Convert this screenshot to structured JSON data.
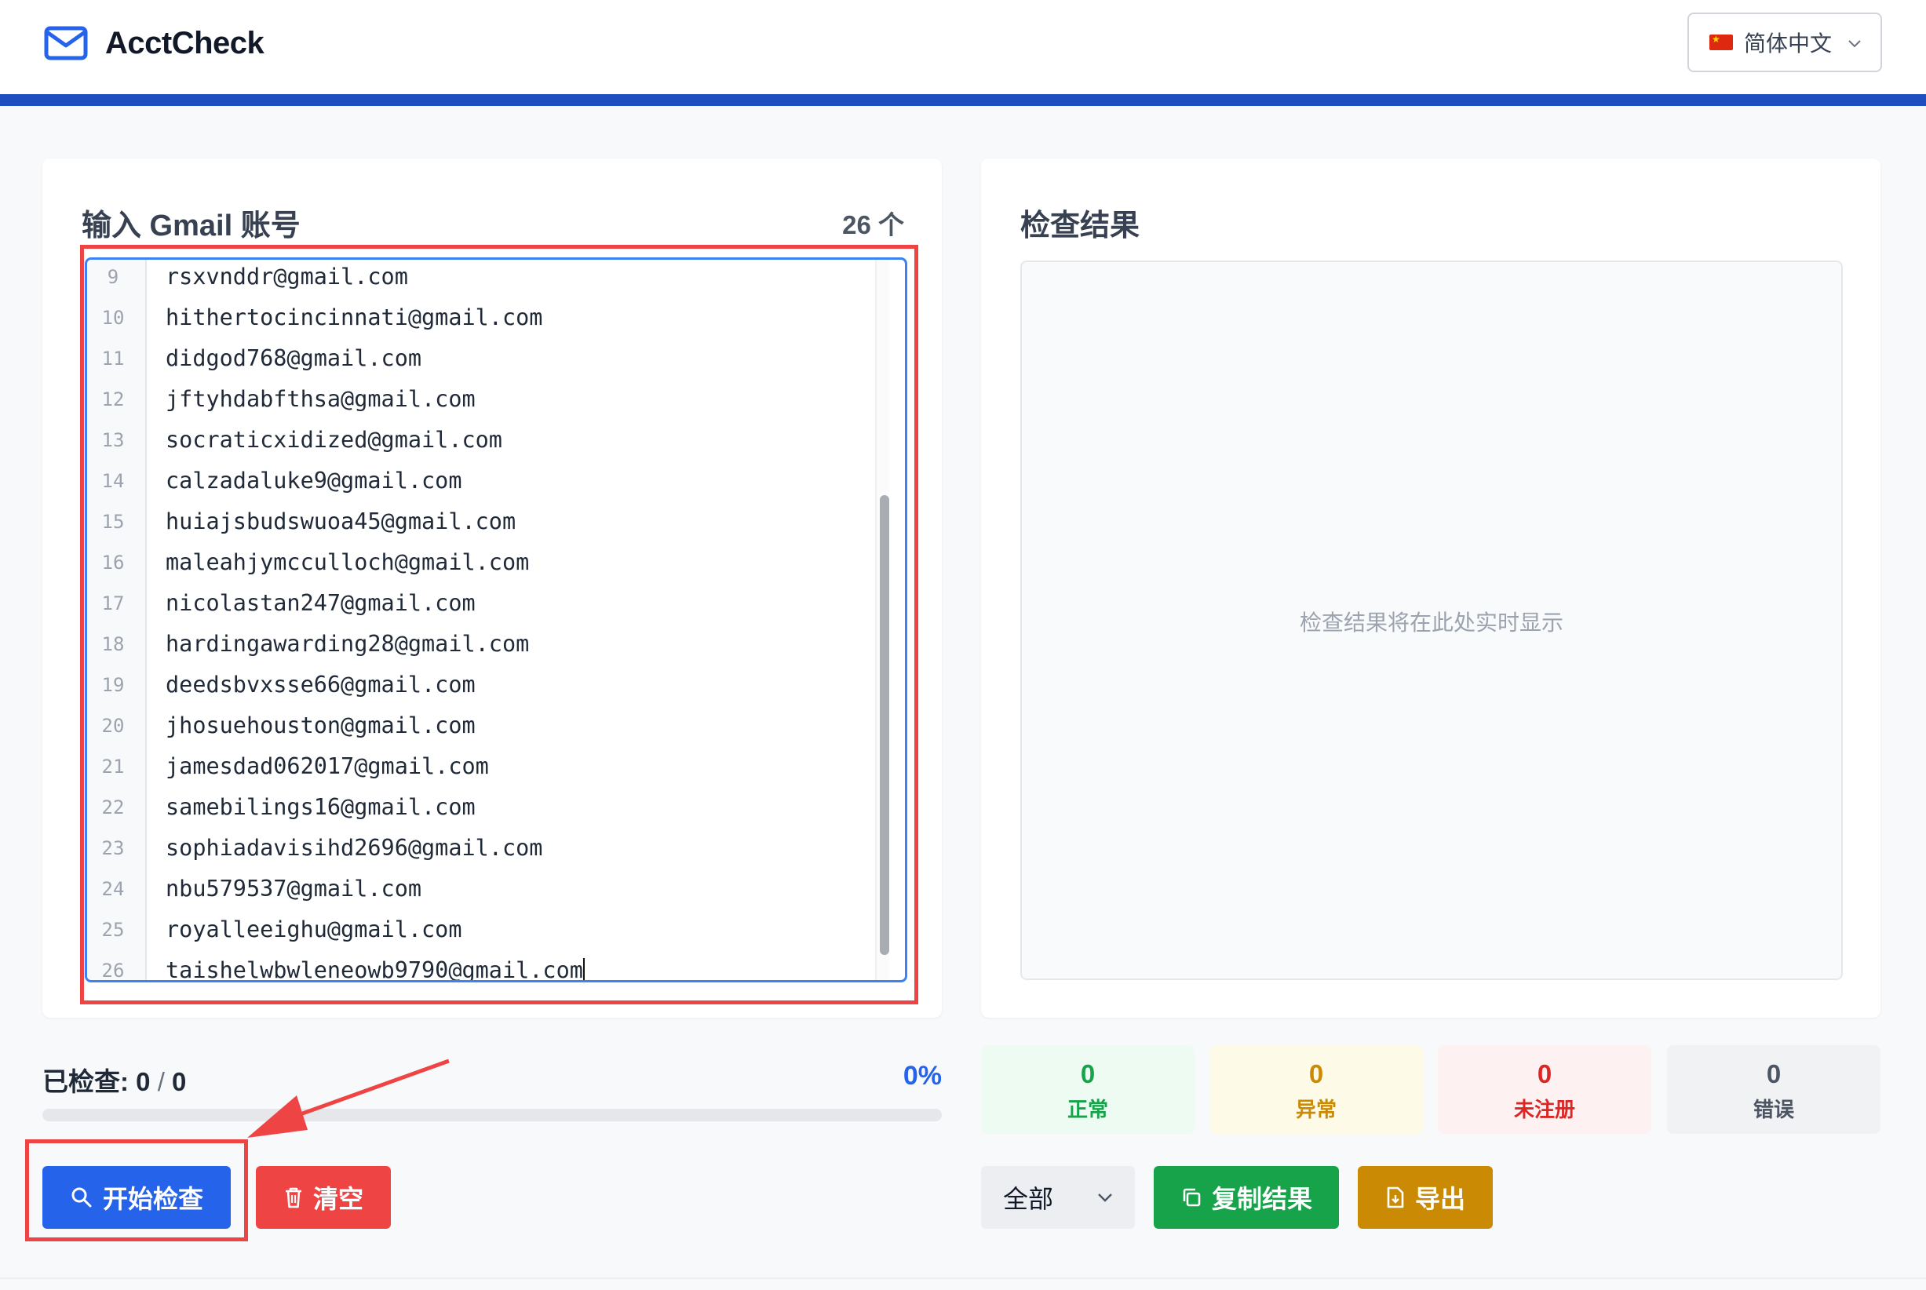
{
  "header": {
    "brand": "AcctCheck",
    "language": "简体中文"
  },
  "input_panel": {
    "title": "输入 Gmail 账号",
    "count_label": "26 个",
    "lines": [
      {
        "no": "9",
        "text": "rsxvnddr@gmail.com"
      },
      {
        "no": "10",
        "text": "hithertocincinnati@gmail.com"
      },
      {
        "no": "11",
        "text": "didgod768@gmail.com"
      },
      {
        "no": "12",
        "text": "jftyhdabfthsa@gmail.com"
      },
      {
        "no": "13",
        "text": "socraticxidized@gmail.com"
      },
      {
        "no": "14",
        "text": "calzadaluke9@gmail.com"
      },
      {
        "no": "15",
        "text": "huiajsbudswuoa45@gmail.com"
      },
      {
        "no": "16",
        "text": "maleahjymcculloch@gmail.com"
      },
      {
        "no": "17",
        "text": "nicolastan247@gmail.com"
      },
      {
        "no": "18",
        "text": "hardingawarding28@gmail.com"
      },
      {
        "no": "19",
        "text": "deedsbvxsse66@gmail.com"
      },
      {
        "no": "20",
        "text": "jhosuehouston@gmail.com"
      },
      {
        "no": "21",
        "text": "jamesdad062017@gmail.com"
      },
      {
        "no": "22",
        "text": "samebilings16@gmail.com"
      },
      {
        "no": "23",
        "text": "sophiadavisihd2696@gmail.com"
      },
      {
        "no": "24",
        "text": "nbu579537@gmail.com"
      },
      {
        "no": "25",
        "text": "royalleeighu@gmail.com"
      },
      {
        "no": "26",
        "text": "taishelwbwleneowb9790@gmail.com"
      }
    ]
  },
  "result_panel": {
    "title": "检查结果",
    "placeholder": "检查结果将在此处实时显示"
  },
  "progress": {
    "label": "已检查:",
    "checked": "0",
    "separator": "/",
    "total": "0",
    "percent_label": "0%",
    "fraction": 0
  },
  "stats": {
    "ok": {
      "value": "0",
      "label": "正常"
    },
    "warn": {
      "value": "0",
      "label": "异常"
    },
    "unregistered": {
      "value": "0",
      "label": "未注册"
    },
    "error": {
      "value": "0",
      "label": "错误"
    }
  },
  "actions": {
    "start": "开始检查",
    "clear": "清空",
    "filter_value": "全部",
    "copy": "复制结果",
    "export": "导出"
  },
  "colors": {
    "primary": "#2563eb",
    "danger": "#ef4444",
    "success": "#16a34a",
    "warning": "#ca8a04",
    "header_bar": "#1f4fbf",
    "annotation": "#ef4444"
  }
}
